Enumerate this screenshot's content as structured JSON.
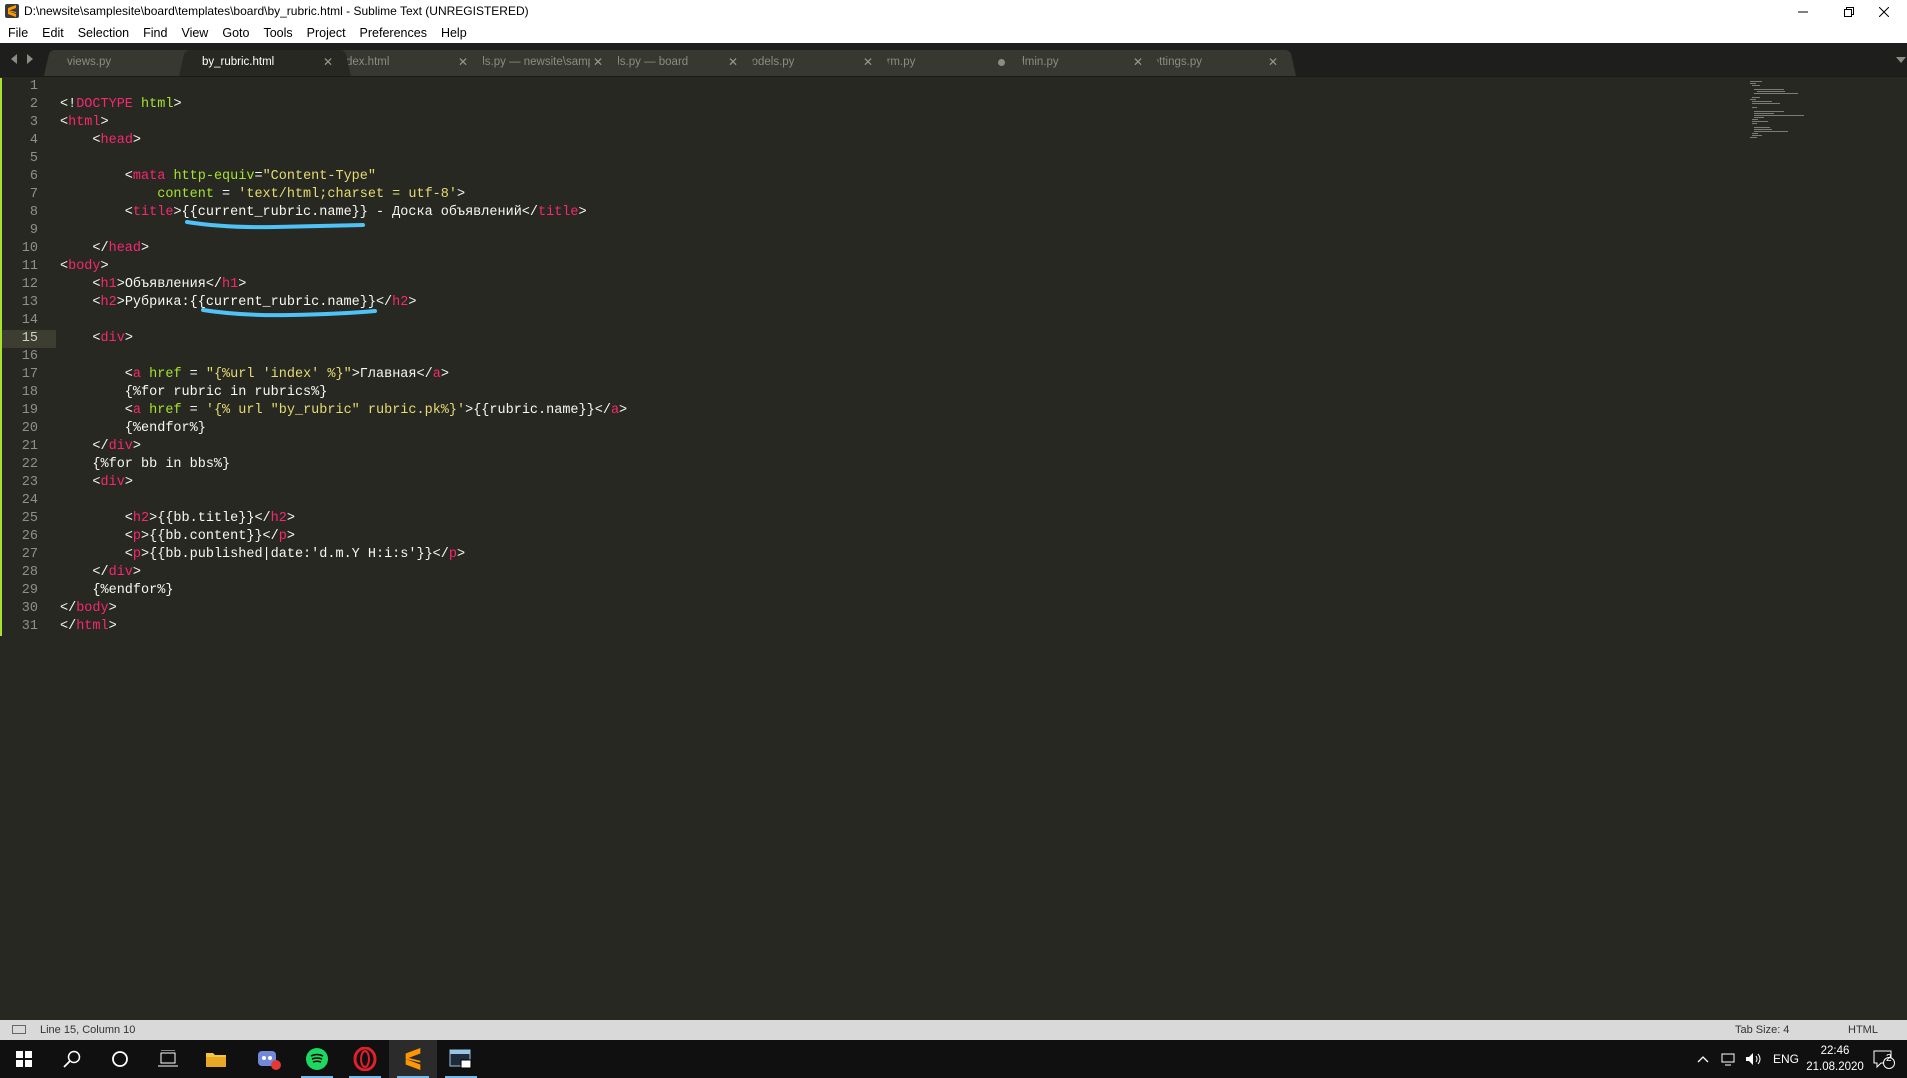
{
  "window": {
    "title": "D:\\newsite\\samplesite\\board\\templates\\board\\by_rubric.html - Sublime Text (UNREGISTERED)"
  },
  "menu": [
    "File",
    "Edit",
    "Selection",
    "Find",
    "View",
    "Goto",
    "Tools",
    "Project",
    "Preferences",
    "Help"
  ],
  "tabs": [
    {
      "label": "views.py",
      "active": false,
      "dirty": false
    },
    {
      "label": "by_rubric.html",
      "active": true,
      "dirty": false
    },
    {
      "label": "index.html",
      "active": false,
      "dirty": false
    },
    {
      "label": "urls.py — newsite\\samplesite\\samplesite",
      "active": false,
      "dirty": false
    },
    {
      "label": "urls.py — board",
      "active": false,
      "dirty": false
    },
    {
      "label": "models.py",
      "active": false,
      "dirty": false
    },
    {
      "label": "form.py",
      "active": false,
      "dirty": true
    },
    {
      "label": "admin.py",
      "active": false,
      "dirty": false
    },
    {
      "label": "settings.py",
      "active": false,
      "dirty": false
    }
  ],
  "editor": {
    "current_line": 15,
    "lines": [
      [],
      [
        [
          "t",
          "<!"
        ],
        [
          "tag",
          "DOCTYPE"
        ],
        [
          "t",
          " "
        ],
        [
          "attr",
          "html"
        ],
        [
          "t",
          ">"
        ]
      ],
      [
        [
          "t",
          "<"
        ],
        [
          "tag",
          "html"
        ],
        [
          "t",
          ">"
        ]
      ],
      [
        [
          "t",
          "    <"
        ],
        [
          "tag",
          "head"
        ],
        [
          "t",
          ">"
        ]
      ],
      [],
      [
        [
          "t",
          "        <"
        ],
        [
          "tag",
          "mata"
        ],
        [
          "t",
          " "
        ],
        [
          "attr",
          "http-equiv"
        ],
        [
          "t",
          "="
        ],
        [
          "str",
          "\"Content-Type\""
        ]
      ],
      [
        [
          "t",
          "            "
        ],
        [
          "attr",
          "content"
        ],
        [
          "t",
          " = "
        ],
        [
          "str",
          "'text/html;charset = utf-8'"
        ],
        [
          "t",
          ">"
        ]
      ],
      [
        [
          "t",
          "        <"
        ],
        [
          "tag",
          "title"
        ],
        [
          "t",
          ">{{current_rubric.name}} - Доска объявлений</"
        ],
        [
          "tag",
          "title"
        ],
        [
          "t",
          ">"
        ]
      ],
      [],
      [
        [
          "t",
          "    </"
        ],
        [
          "tag",
          "head"
        ],
        [
          "t",
          ">"
        ]
      ],
      [
        [
          "t",
          "<"
        ],
        [
          "tag",
          "body"
        ],
        [
          "t",
          ">"
        ]
      ],
      [
        [
          "t",
          "    <"
        ],
        [
          "tag",
          "h1"
        ],
        [
          "t",
          ">Объявления</"
        ],
        [
          "tag",
          "h1"
        ],
        [
          "t",
          ">"
        ]
      ],
      [
        [
          "t",
          "    <"
        ],
        [
          "tag",
          "h2"
        ],
        [
          "t",
          ">Рубрика:{{current_rubric.name}}</"
        ],
        [
          "tag",
          "h2"
        ],
        [
          "t",
          ">"
        ]
      ],
      [],
      [
        [
          "t",
          "    <"
        ],
        [
          "tag",
          "div"
        ],
        [
          "t",
          ">"
        ]
      ],
      [],
      [
        [
          "t",
          "        <"
        ],
        [
          "tag",
          "a"
        ],
        [
          "t",
          " "
        ],
        [
          "attr",
          "href"
        ],
        [
          "t",
          " = "
        ],
        [
          "str",
          "\"{%url 'index' %}\""
        ],
        [
          "t",
          ">Главная</"
        ],
        [
          "tag",
          "a"
        ],
        [
          "t",
          ">"
        ]
      ],
      [
        [
          "t",
          "        {%for rubric in rubrics%}"
        ]
      ],
      [
        [
          "t",
          "        <"
        ],
        [
          "tag",
          "a"
        ],
        [
          "t",
          " "
        ],
        [
          "attr",
          "href"
        ],
        [
          "t",
          " = "
        ],
        [
          "str",
          "'{% url \"by_rubric\" rubric.pk%}'"
        ],
        [
          "t",
          ">{{rubric.name}}</"
        ],
        [
          "tag",
          "a"
        ],
        [
          "t",
          ">"
        ]
      ],
      [
        [
          "t",
          "        {%endfor%}"
        ]
      ],
      [
        [
          "t",
          "    </"
        ],
        [
          "tag",
          "div"
        ],
        [
          "t",
          ">"
        ]
      ],
      [
        [
          "t",
          "    {%for bb in bbs%}"
        ]
      ],
      [
        [
          "t",
          "    <"
        ],
        [
          "tag",
          "div"
        ],
        [
          "t",
          ">"
        ]
      ],
      [],
      [
        [
          "t",
          "        <"
        ],
        [
          "tag",
          "h2"
        ],
        [
          "t",
          ">{{bb.title}}</"
        ],
        [
          "tag",
          "h2"
        ],
        [
          "t",
          ">"
        ]
      ],
      [
        [
          "t",
          "        <"
        ],
        [
          "tag",
          "p"
        ],
        [
          "t",
          ">{{bb.content}}</"
        ],
        [
          "tag",
          "p"
        ],
        [
          "t",
          ">"
        ]
      ],
      [
        [
          "t",
          "        <"
        ],
        [
          "tag",
          "p"
        ],
        [
          "t",
          ">{{bb.published|date:'d.m.Y H:i:s'}}</"
        ],
        [
          "tag",
          "p"
        ],
        [
          "t",
          ">"
        ]
      ],
      [
        [
          "t",
          "    </"
        ],
        [
          "tag",
          "div"
        ],
        [
          "t",
          ">"
        ]
      ],
      [
        [
          "t",
          "    {%endfor%}"
        ]
      ],
      [
        [
          "t",
          "</"
        ],
        [
          "tag",
          "body"
        ],
        [
          "t",
          ">"
        ]
      ],
      [
        [
          "t",
          "</"
        ],
        [
          "tag",
          "html"
        ],
        [
          "t",
          ">"
        ]
      ]
    ]
  },
  "status": {
    "position": "Line 15, Column 10",
    "tab_size": "Tab Size: 4",
    "syntax": "HTML"
  },
  "taskbar": {
    "language": "ENG",
    "time": "22:46",
    "date": "21.08.2020",
    "notifications": "2",
    "apps": [
      "start-icon",
      "search-icon",
      "cortana-icon",
      "task-view-icon",
      "file-explorer-icon",
      "discord-icon",
      "spotify-icon",
      "opera-icon",
      "sublime-text-icon",
      "terminal-icon"
    ]
  },
  "colors": {
    "tag": "#f92672",
    "attr": "#a6e22e",
    "string": "#e6db74",
    "text": "#f8f8f2",
    "background": "#272822",
    "annotation": "#4fc3f7"
  }
}
